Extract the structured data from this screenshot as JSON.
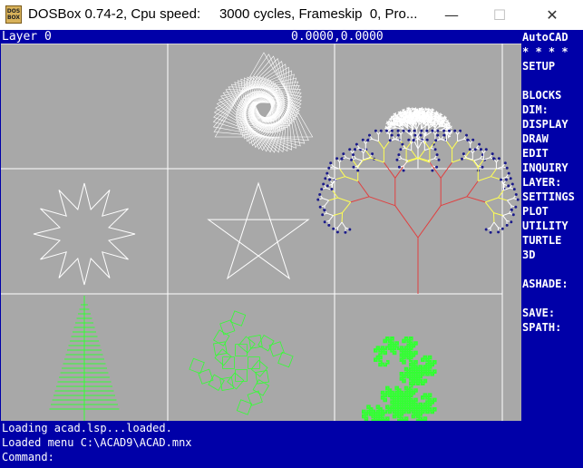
{
  "window": {
    "title": "DOSBox 0.74-2, Cpu speed:     3000 cycles, Frameskip  0, Pro...",
    "icon_label": "DOS BOX",
    "minimize_glyph": "—",
    "maximize_glyph": "☐",
    "close_glyph": "✕"
  },
  "status": {
    "layer": "Layer 0",
    "coords": "0.0000,0.0000"
  },
  "side_menu": {
    "items": [
      "AutoCAD",
      "* * * *",
      "SETUP",
      "",
      "BLOCKS",
      "DIM:",
      "DISPLAY",
      "DRAW",
      "EDIT",
      "INQUIRY",
      "LAYER:",
      "SETTINGS",
      "PLOT",
      "UTILITY",
      "TURTLE",
      "3D",
      "",
      "ASHADE:",
      "",
      "SAVE:",
      "SPATH:"
    ]
  },
  "command_area": {
    "lines": [
      "Loading acad.lsp...loaded.",
      "Loaded menu C:\\ACAD9\\ACAD.mnx",
      "Command:"
    ]
  },
  "drawing": {
    "grid": "3x3",
    "colors": {
      "background": "#a8a8a8",
      "white": "#ffffff",
      "green": "#33ff33",
      "red": "#e04040",
      "yellow": "#ffff55",
      "dark": "#1b1b8a"
    },
    "figures": [
      "spiral-triangles",
      "fractal-tree-white",
      "twelve-point-star",
      "pentagram",
      "fractal-tree-color",
      "fern-fractal",
      "rotated-squares-pattern",
      "dragon-curve"
    ]
  }
}
